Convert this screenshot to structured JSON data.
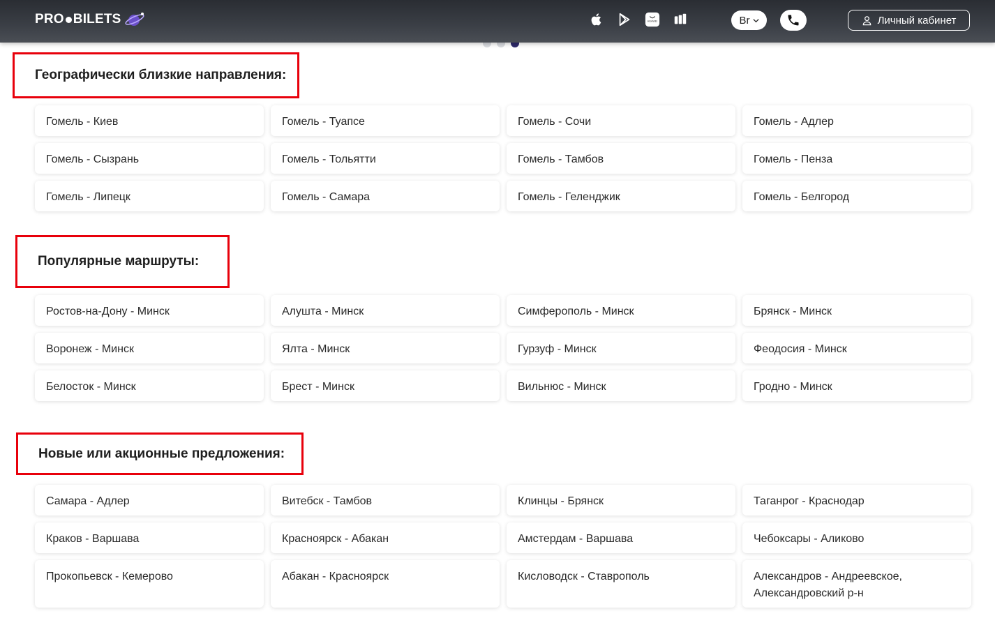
{
  "header": {
    "logo_text_left": "PRO",
    "logo_text_right": "BILETS",
    "lang_label": "Br",
    "cabinet_label": "Личный кабинет",
    "store_icons": [
      "apple-icon",
      "google-play-icon",
      "huawei-appgallery-icon",
      "rustore-icon"
    ]
  },
  "carousel": {
    "dots": 3,
    "active": 3
  },
  "sections": [
    {
      "title": "Географически близкие направления:",
      "routes": [
        "Гомель - Киев",
        "Гомель - Туапсе",
        "Гомель - Сочи",
        "Гомель - Адлер",
        "Гомель - Сызрань",
        "Гомель - Тольятти",
        "Гомель - Тамбов",
        "Гомель - Пенза",
        "Гомель - Липецк",
        "Гомель - Самара",
        "Гомель - Геленджик",
        "Гомель - Белгород"
      ]
    },
    {
      "title": "Популярные маршруты:",
      "routes": [
        "Ростов-на-Дону - Минск",
        "Алушта - Минск",
        "Симферополь - Минск",
        "Брянск - Минск",
        "Воронеж - Минск",
        "Ялта - Минск",
        "Гурзуф - Минск",
        "Феодосия - Минск",
        "Белосток - Минск",
        "Брест - Минск",
        "Вильнюс - Минск",
        "Гродно - Минск"
      ]
    },
    {
      "title": "Новые или акционные предложения:",
      "routes": [
        "Самара - Адлер",
        "Витебск - Тамбов",
        "Клинцы - Брянск",
        "Таганрог - Краснодар",
        "Краков - Варшава",
        "Красноярск - Абакан",
        "Амстердам - Варшава",
        "Чебоксары - Аликово",
        "Прокопьевск - Кемерово",
        "Абакан - Красноярск",
        "Кисловодск - Ставрополь",
        "Александров - Андреевское, Александровский р-н"
      ]
    }
  ],
  "colors": {
    "highlight_border": "#e8000b",
    "header_bg": "#3b3f46",
    "active_dot": "#2e2a6b"
  }
}
